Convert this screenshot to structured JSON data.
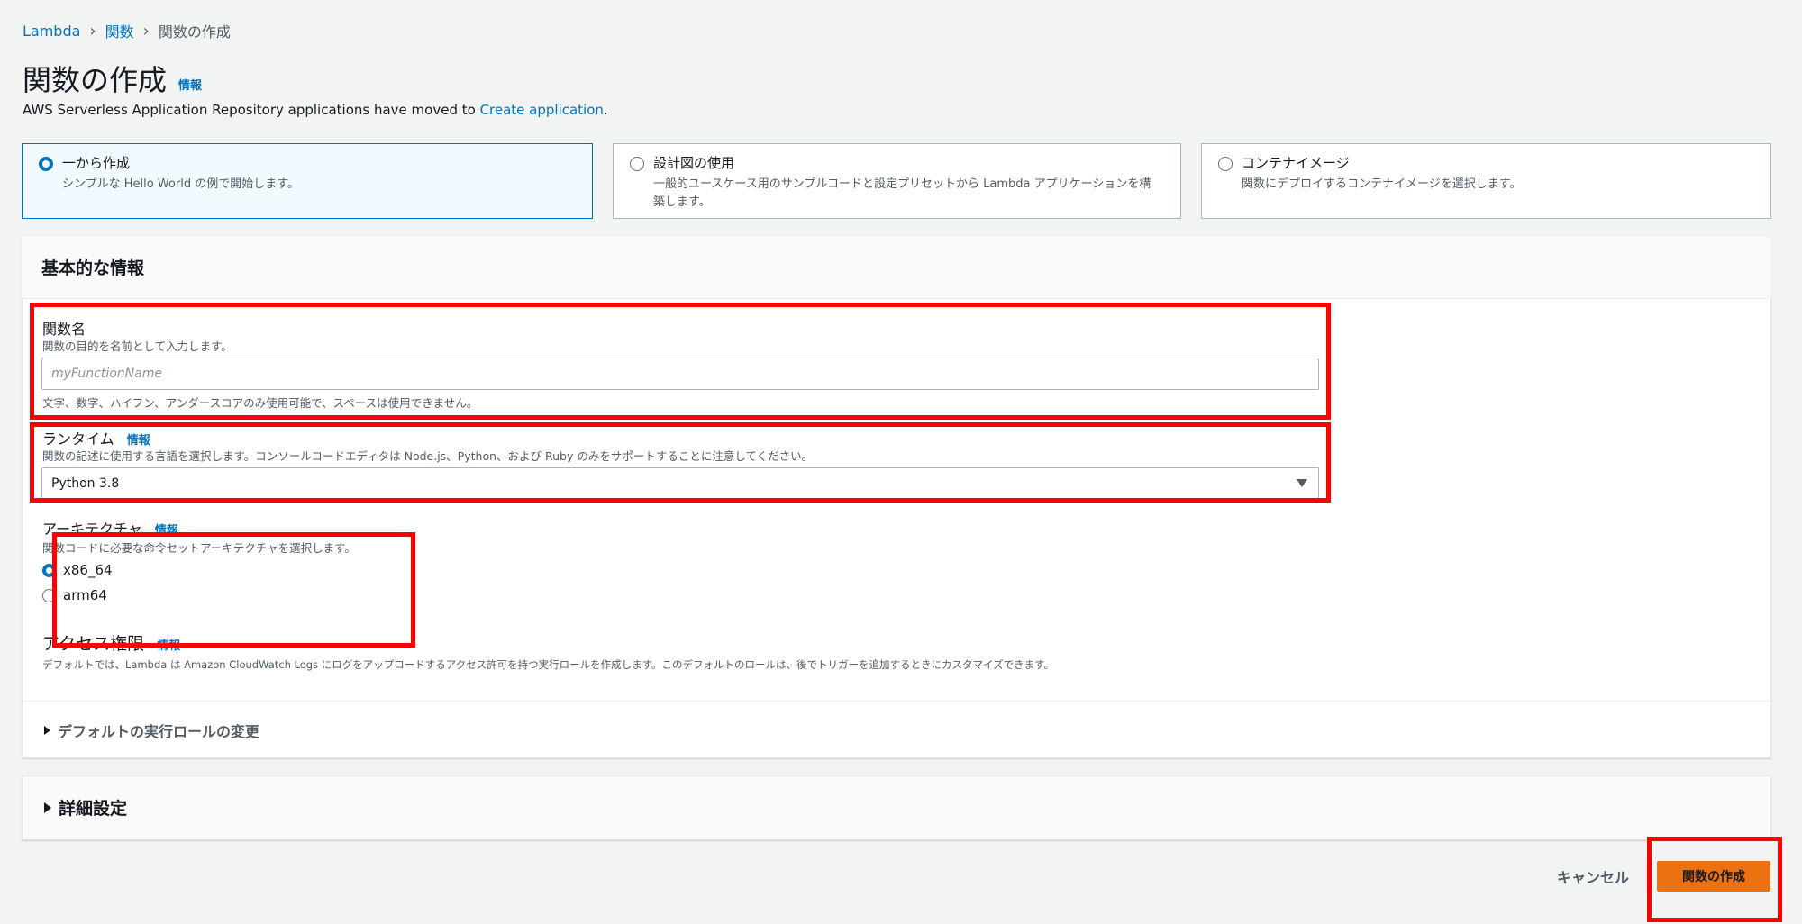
{
  "breadcrumb": [
    "Lambda",
    "関数",
    "関数の作成"
  ],
  "page": {
    "title": "関数の作成",
    "info": "情報",
    "notice_text": "AWS Serverless Application Repository applications have moved to ",
    "notice_link": "Create application",
    "notice_end": "."
  },
  "options": [
    {
      "title": "一から作成",
      "desc": "シンプルな Hello World の例で開始します。",
      "selected": true
    },
    {
      "title": "設計図の使用",
      "desc": "一般的ユースケース用のサンプルコードと設定プリセットから Lambda アプリケーションを構築します。",
      "selected": false
    },
    {
      "title": "コンテナイメージ",
      "desc": "関数にデプロイするコンテナイメージを選択します。",
      "selected": false
    }
  ],
  "basic": {
    "title": "基本的な情報",
    "function_name": {
      "label": "関数名",
      "desc": "関数の目的を名前として入力します。",
      "placeholder": "myFunctionName",
      "hint": "文字、数字、ハイフン、アンダースコアのみ使用可能で、スペースは使用できません。"
    },
    "runtime": {
      "label": "ランタイム",
      "info": "情報",
      "desc": "関数の記述に使用する言語を選択します。コンソールコードエディタは Node.js、Python、および Ruby のみをサポートすることに注意してください。",
      "value": "Python 3.8"
    },
    "architecture": {
      "label": "アーキテクチャ",
      "info": "情報",
      "desc": "関数コードに必要な命令セットアーキテクチャを選択します。",
      "options": [
        "x86_64",
        "arm64"
      ],
      "selected": "x86_64"
    },
    "permissions": {
      "label": "アクセス権限",
      "info": "情報",
      "desc": "デフォルトでは、Lambda は Amazon CloudWatch Logs にログをアップロードするアクセス許可を持つ実行ロールを作成します。このデフォルトのロールは、後でトリガーを追加するときにカスタマイズできます。"
    },
    "role_expander": "デフォルトの実行ロールの変更"
  },
  "advanced": {
    "title": "詳細設定"
  },
  "actions": {
    "cancel": "キャンセル",
    "create": "関数の作成"
  },
  "colors": {
    "accent": "#0073bb",
    "primary": "#ec7211",
    "highlight": "#ff0000"
  }
}
